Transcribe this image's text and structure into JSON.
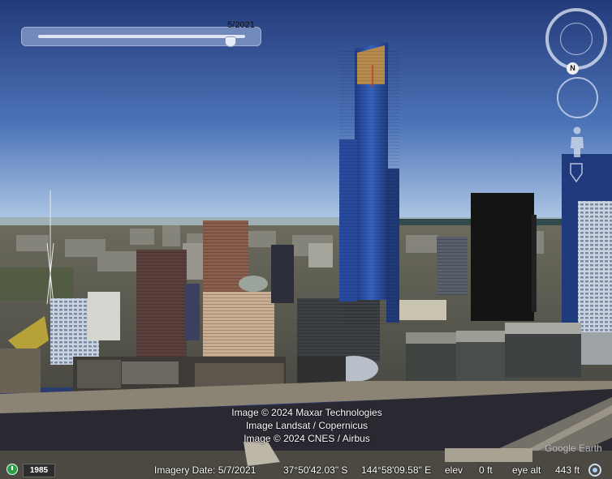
{
  "time_slider": {
    "label": "5/2021",
    "position": 0.93
  },
  "navigation": {
    "north_label": "N"
  },
  "attribution": [
    "Image © 2024 Maxar Technologies",
    "Image Landsat / Copernicus",
    "Image © 2024 CNES / Airbus"
  ],
  "logo": "Google Earth",
  "status_bar": {
    "historical_year": "1985",
    "imagery_date": "Imagery Date: 5/7/2021",
    "latitude": "37°50'42.03\" S",
    "longitude": "144°58'09.58\" E",
    "elev_label": "elev",
    "elev_value": "0 ft",
    "eye_alt_label": "eye alt",
    "eye_alt_value": "443 ft"
  },
  "colors": {
    "sky_top": "#233a7a",
    "sky_bottom": "#a9c6e4",
    "river": "#2a2932",
    "tower_glass": "#2b4fa8",
    "tower_gold": "#b58a4a"
  }
}
